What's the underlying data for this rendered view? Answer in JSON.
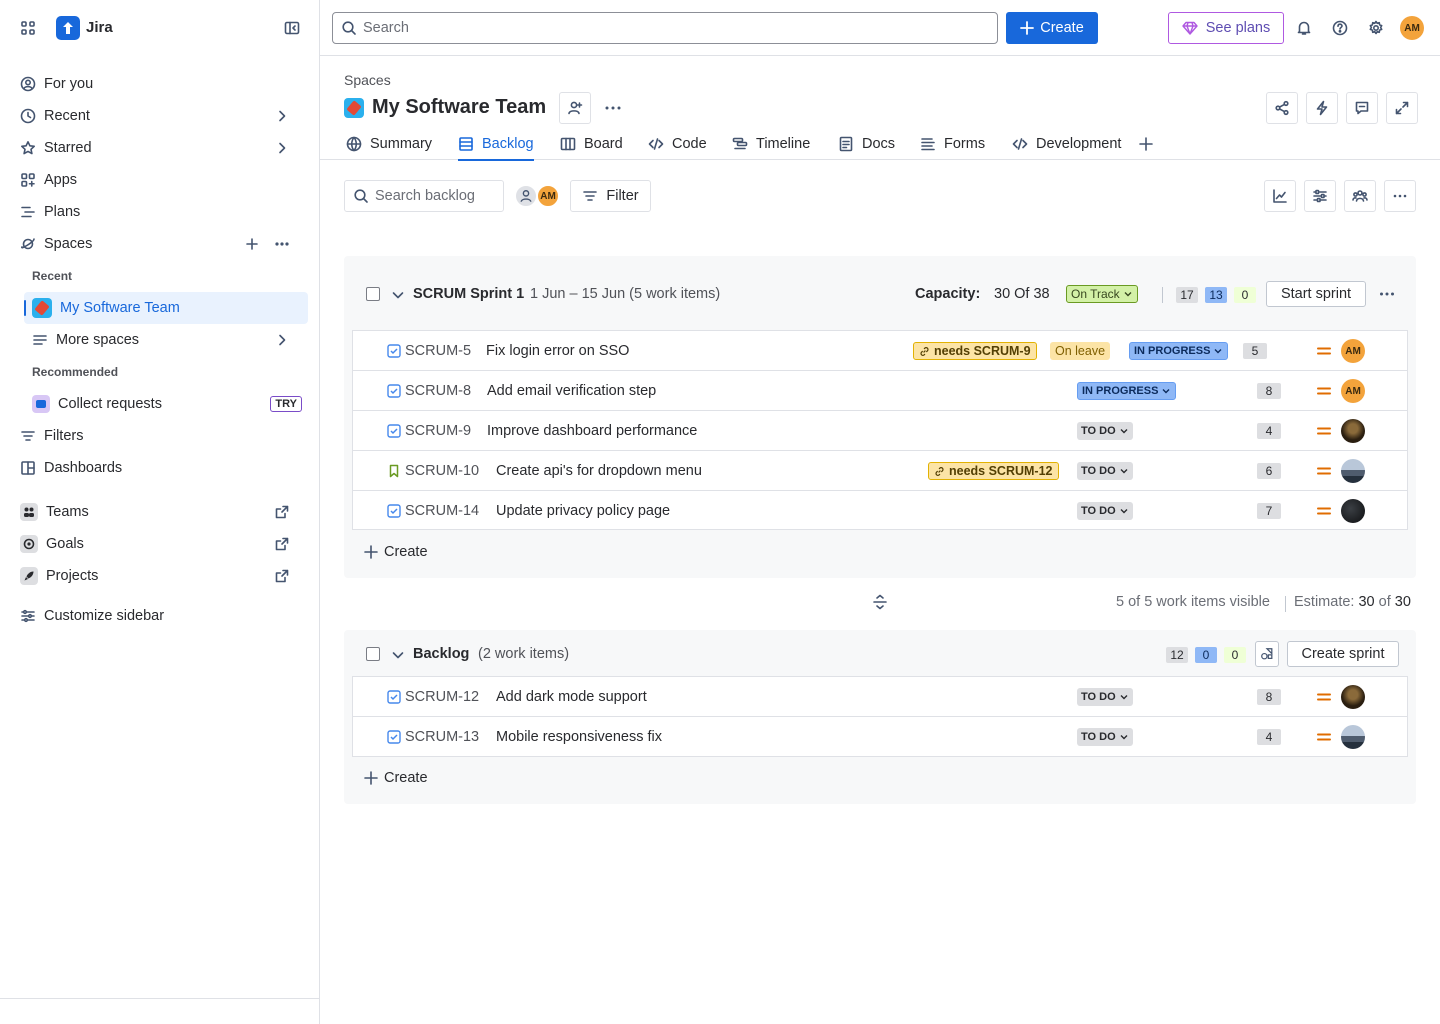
{
  "app": {
    "name": "Jira"
  },
  "sidebar": {
    "items": [
      {
        "label": "For you",
        "icon": "person-circle-icon"
      },
      {
        "label": "Recent",
        "icon": "clock-icon"
      },
      {
        "label": "Starred",
        "icon": "star-icon"
      },
      {
        "label": "Apps",
        "icon": "apps-icon"
      },
      {
        "label": "Plans",
        "icon": "plans-icon"
      },
      {
        "label": "Spaces",
        "icon": "spaces-icon"
      }
    ],
    "recent_label": "Recent",
    "active_space": "My Software Team",
    "more_spaces": "More spaces",
    "recommended_label": "Recommended",
    "collect_requests": "Collect requests",
    "try_badge": "TRY",
    "filters": "Filters",
    "dashboards": "Dashboards",
    "teams": "Teams",
    "goals": "Goals",
    "projects": "Projects",
    "customize": "Customize sidebar"
  },
  "topbar": {
    "search_placeholder": "Search",
    "create_label": "Create",
    "plans_label": "See plans",
    "user_initials": "AM"
  },
  "header": {
    "breadcrumb": "Spaces",
    "title": "My Software Team"
  },
  "tabs": [
    {
      "label": "Summary"
    },
    {
      "label": "Backlog"
    },
    {
      "label": "Board"
    },
    {
      "label": "Code"
    },
    {
      "label": "Timeline"
    },
    {
      "label": "Docs"
    },
    {
      "label": "Forms"
    },
    {
      "label": "Development"
    }
  ],
  "toolbar": {
    "search_placeholder": "Search backlog",
    "filter_label": "Filter",
    "avatar_initials": "AM"
  },
  "sprint": {
    "name": "SCRUM Sprint 1",
    "meta": "1 Jun – 15 Jun (5 work items)",
    "capacity_label": "Capacity:",
    "capacity_value": "30 Of 38",
    "status": "On Track",
    "counts": {
      "todo": "17",
      "in_progress": "13",
      "done": "0"
    },
    "start_label": "Start sprint",
    "create_label": "Create",
    "items": [
      {
        "key": "SCRUM-5",
        "summary": "Fix login error on SSO",
        "dependency": "needs SCRUM-9",
        "leave": "On leave",
        "status": "IN PROGRESS",
        "estimate": "5",
        "assignee": "AM"
      },
      {
        "key": "SCRUM-8",
        "summary": "Add email verification step",
        "status": "IN PROGRESS",
        "estimate": "8",
        "assignee": "AM"
      },
      {
        "key": "SCRUM-9",
        "summary": "Improve dashboard performance",
        "status": "TO DO",
        "estimate": "4"
      },
      {
        "key": "SCRUM-10",
        "summary": "Create api's for dropdown menu",
        "dependency": "needs SCRUM-12",
        "status": "TO DO",
        "estimate": "6"
      },
      {
        "key": "SCRUM-14",
        "summary": "Update privacy policy page",
        "status": "TO DO",
        "estimate": "7"
      }
    ]
  },
  "summary_bar": {
    "visible": "5 of 5 work items visible",
    "estimate_label": "Estimate:",
    "estimate_value": "30",
    "estimate_of": "of",
    "estimate_total": "30"
  },
  "backlog": {
    "name": "Backlog",
    "meta": "(2 work items)",
    "counts": {
      "todo": "12",
      "in_progress": "0",
      "done": "0"
    },
    "create_sprint_label": "Create sprint",
    "create_label": "Create",
    "items": [
      {
        "key": "SCRUM-12",
        "summary": "Add dark mode support",
        "status": "TO DO",
        "estimate": "8"
      },
      {
        "key": "SCRUM-13",
        "summary": "Mobile responsiveness fix",
        "status": "TO DO",
        "estimate": "4"
      }
    ]
  }
}
